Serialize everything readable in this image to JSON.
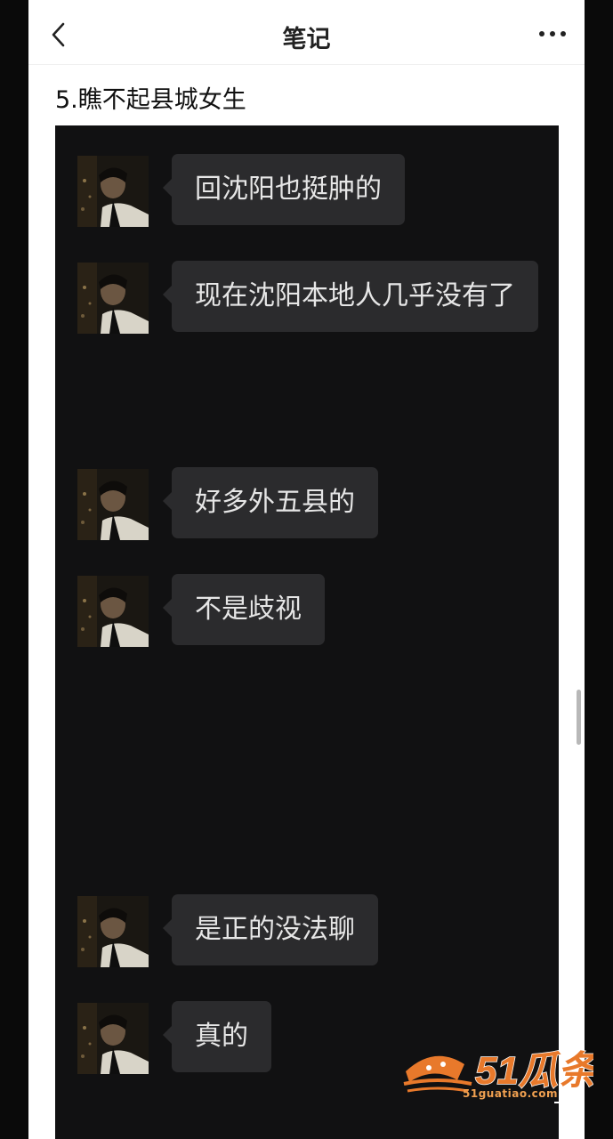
{
  "header": {
    "title": "笔记"
  },
  "note": {
    "subtitle": "5.瞧不起县城女生"
  },
  "chat": {
    "messages": [
      {
        "text": "回沈阳也挺肿的"
      },
      {
        "text": "现在沈阳本地人几乎没有了"
      },
      {
        "text": "好多外五县的"
      },
      {
        "text": "不是歧视"
      },
      {
        "text": "是正的没法聊"
      },
      {
        "text": "真的"
      }
    ]
  },
  "watermark": {
    "brand": "51瓜条",
    "site": "51guatiao.com"
  },
  "colors": {
    "chat_bg": "#111112",
    "bubble": "#2b2b2d",
    "bubble_text": "#e6e6e6",
    "watermark": "#e8792b"
  },
  "icons": {
    "back": "chevron-left-icon",
    "more": "more-dots-icon",
    "corner": "collapse-icon"
  }
}
